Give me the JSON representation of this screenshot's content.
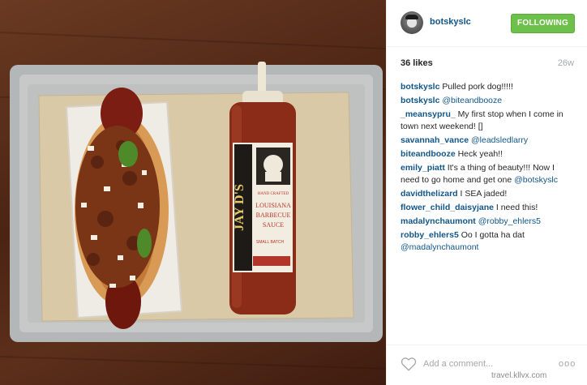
{
  "post": {
    "username": "botskyslc",
    "follow_label": "FOLLOWING",
    "likes": "36 likes",
    "age": "26w",
    "add_comment_placeholder": "Add a comment...",
    "more_label": "ooo"
  },
  "bottle_label": {
    "brand": "JAY D'S",
    "subtitle": "HAND CRAFTED",
    "line1": "LOUISIANA",
    "line2": "BARBECUE",
    "line3": "SAUCE",
    "batch": "SMALL BATCH"
  },
  "comments": [
    {
      "user": "botskyslc",
      "text": " Pulled pork dog!!!!!",
      "mention": ""
    },
    {
      "user": "botskyslc",
      "text": " ",
      "mention": "@biteandbooze"
    },
    {
      "user": "_meansypru_",
      "text": " My first stop when I come in town next weekend! []",
      "mention": ""
    },
    {
      "user": "savannah_vance",
      "text": " ",
      "mention": "@leadsledlarry"
    },
    {
      "user": "biteandbooze",
      "text": " Heck yeah!!",
      "mention": ""
    },
    {
      "user": "emily_piatt",
      "text": " It's a thing of beauty!!! Now I need to go home and get one ",
      "mention": "@botskyslc"
    },
    {
      "user": "davidthelizard",
      "text": " I SEA jaded!",
      "mention": ""
    },
    {
      "user": "flower_child_daisyjane",
      "text": " I need this!",
      "mention": ""
    },
    {
      "user": "madalynchaumont",
      "text": " ",
      "mention": "@robby_ehlers5"
    },
    {
      "user": "robby_ehlers5",
      "text": " Oo I gotta ha dat ",
      "mention": "@madalynchaumont"
    }
  ],
  "watermark": "travel.kllvx.com"
}
